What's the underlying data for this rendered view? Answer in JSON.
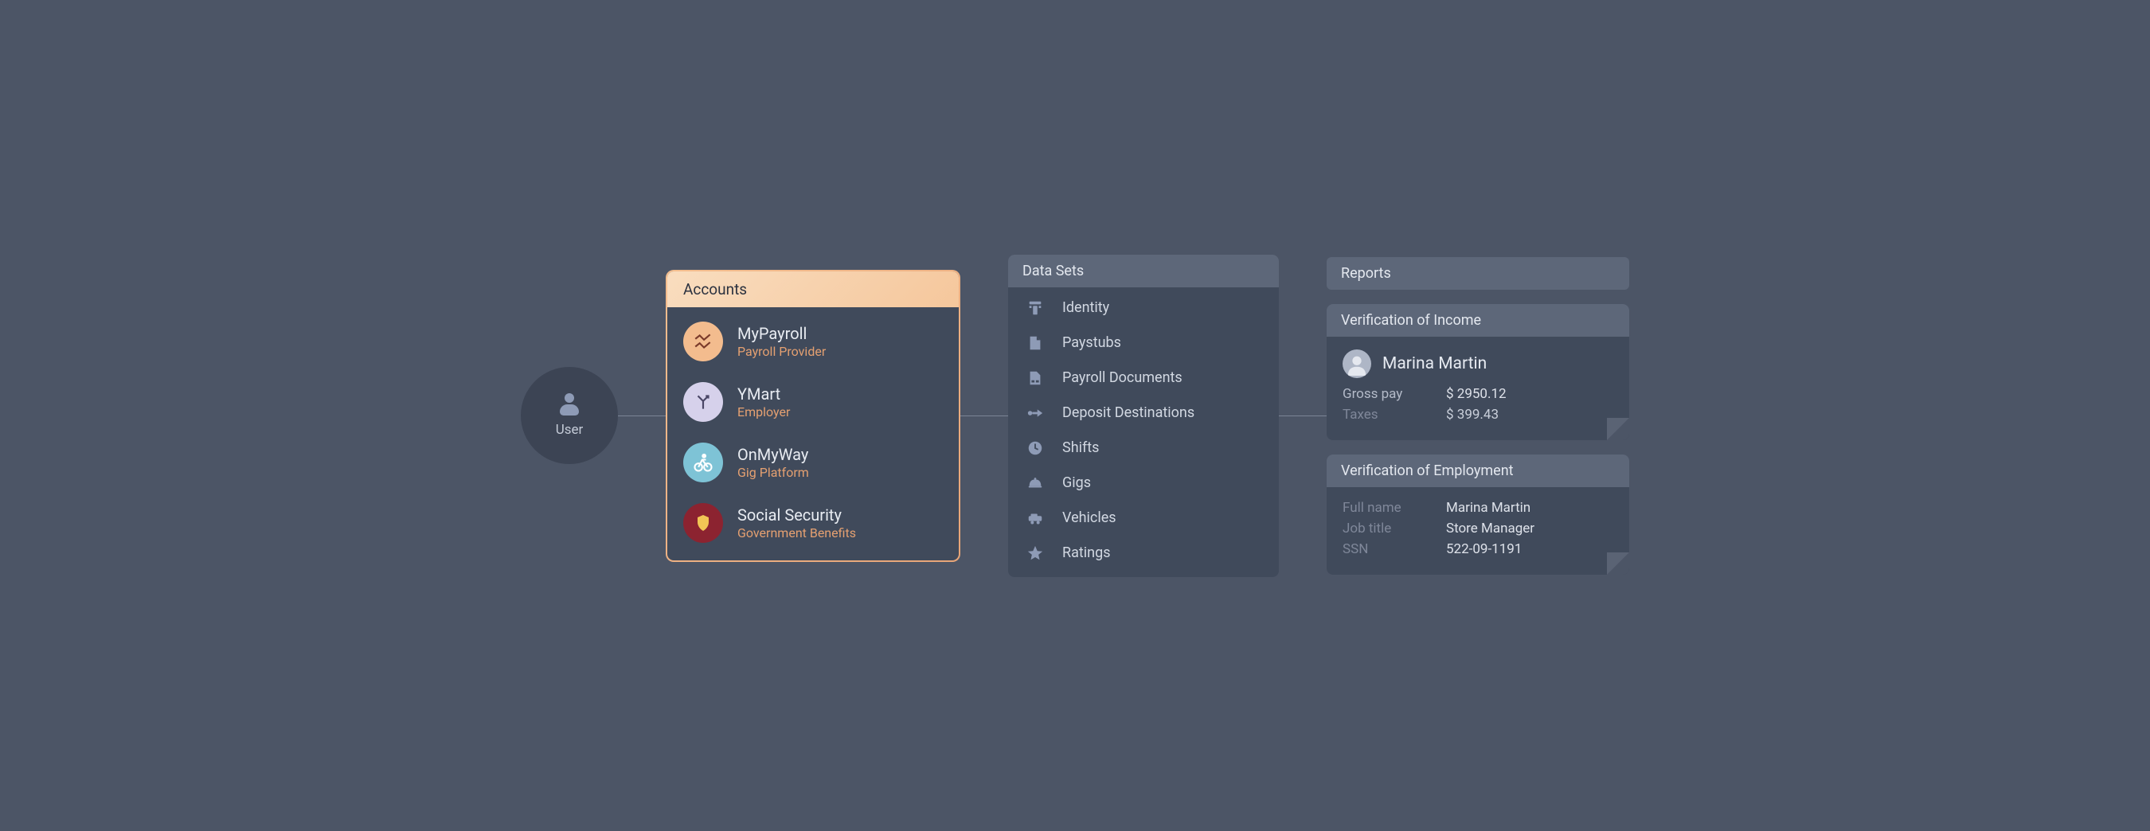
{
  "user": {
    "label": "User"
  },
  "accounts": {
    "title": "Accounts",
    "items": [
      {
        "name": "MyPayroll",
        "sub": "Payroll Provider",
        "icon": "chart-lines-icon",
        "color": "peach"
      },
      {
        "name": "YMart",
        "sub": "Employer",
        "icon": "branch-icon",
        "color": "lilac"
      },
      {
        "name": "OnMyWay",
        "sub": "Gig Platform",
        "icon": "bicycle-icon",
        "color": "sky"
      },
      {
        "name": "Social Security",
        "sub": "Government Benefits",
        "icon": "shield-icon",
        "color": "maroon"
      }
    ]
  },
  "datasets": {
    "title": "Data Sets",
    "items": [
      {
        "label": "Identity",
        "icon": "identity-icon"
      },
      {
        "label": "Paystubs",
        "icon": "file-icon"
      },
      {
        "label": "Payroll Documents",
        "icon": "document-icon"
      },
      {
        "label": "Deposit Destinations",
        "icon": "arrow-right-icon"
      },
      {
        "label": "Shifts",
        "icon": "clock-icon"
      },
      {
        "label": "Gigs",
        "icon": "bell-icon"
      },
      {
        "label": "Vehicles",
        "icon": "car-icon"
      },
      {
        "label": "Ratings",
        "icon": "star-icon"
      }
    ]
  },
  "reports": {
    "title": "Reports",
    "income": {
      "title": "Verification of Income",
      "person": "Marina Martin",
      "rows": [
        {
          "k": "Gross pay",
          "v": "$ 2950.12"
        },
        {
          "k": "Taxes",
          "v": "$ 399.43"
        }
      ]
    },
    "employment": {
      "title": "Verification of Employment",
      "rows": [
        {
          "k": "Full name",
          "v": "Marina Martin"
        },
        {
          "k": "Job title",
          "v": "Store Manager"
        },
        {
          "k": "SSN",
          "v": "522-09-1191"
        }
      ]
    }
  }
}
